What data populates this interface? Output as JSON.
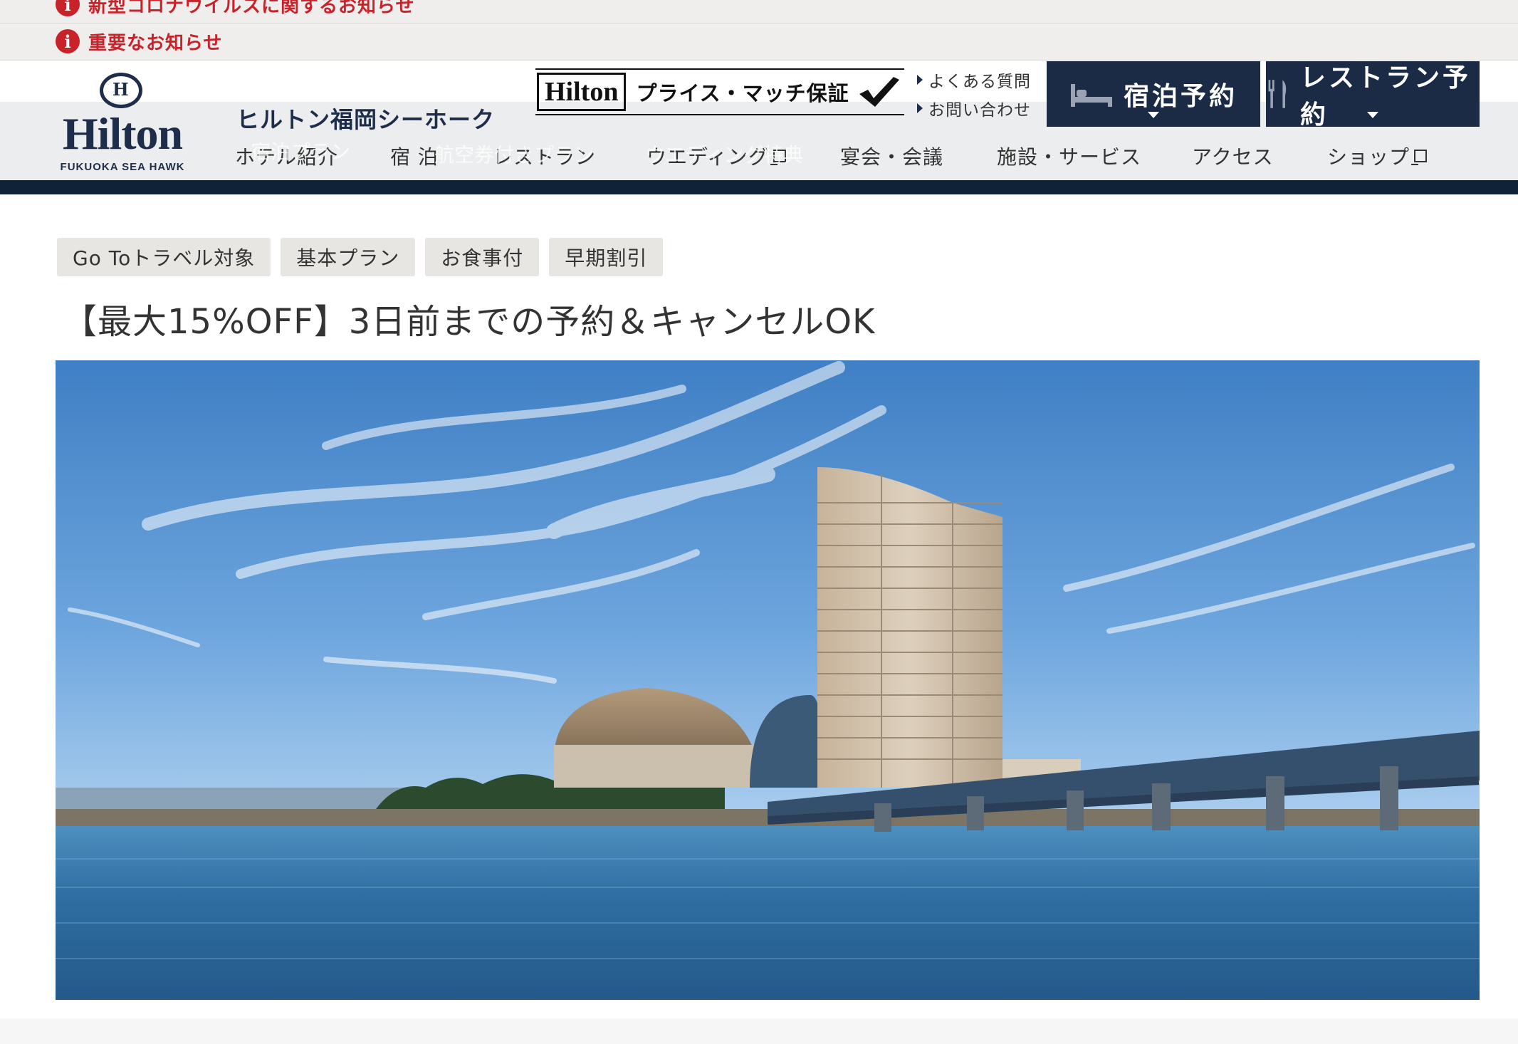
{
  "notices": {
    "item1": "新型コロナウイルスに関するお知らせ",
    "item2": "重要なお知らせ",
    "icon": "info-icon",
    "color": "#c8222b"
  },
  "header": {
    "logo": {
      "word": "Hilton",
      "sub": "FUKUOKA SEA HAWK",
      "mark": "H"
    },
    "hotel_name": "ヒルトン福岡シーホーク",
    "price_match": {
      "brand": "Hilton",
      "text": "プライス・マッチ保証"
    },
    "util_links": [
      "よくある質問",
      "お問い合わせ"
    ],
    "book_stay": "宿泊予約",
    "book_restaurant": "レストラン予約",
    "navy": "#1b2b45"
  },
  "nav": {
    "items": [
      "ホテル紹介",
      "宿 泊",
      "レストラン",
      "ウエディング",
      "宴会・会議",
      "施設・サービス",
      "アクセス",
      "ショップ"
    ],
    "ghost": [
      "宿泊プラン",
      "航空券付きプラン",
      "ウエディング特典"
    ]
  },
  "tags": [
    "Go Toトラベル対象",
    "基本プラン",
    "お食事付",
    "早期割引"
  ],
  "plan_title": "【最大15%OFF】3日前までの予約＆キャンセルOK",
  "hero": {
    "alt_icon": "hotel-photo"
  }
}
